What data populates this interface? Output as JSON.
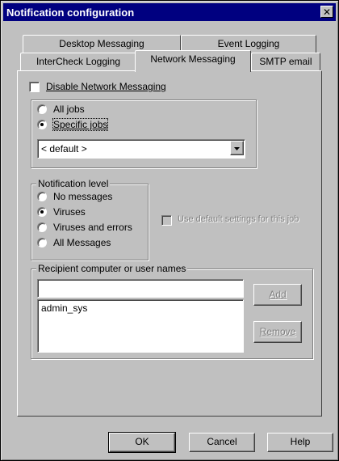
{
  "window": {
    "title": "Notification configuration",
    "close_icon": "close-icon"
  },
  "tabs": {
    "row1": [
      "Desktop Messaging",
      "Event Logging"
    ],
    "row2": [
      "InterCheck Logging",
      "Network Messaging",
      "SMTP email"
    ],
    "active": "Network Messaging"
  },
  "network": {
    "disable_label": "Disable Network Messaging",
    "disable_checked": false,
    "jobs": {
      "all_label": "All jobs",
      "specific_label": "Specific jobs",
      "selected": "Specific jobs",
      "dropdown_value": "< default >"
    },
    "level": {
      "title": "Notification level",
      "options": [
        "No messages",
        "Viruses",
        "Viruses and errors",
        "All Messages"
      ],
      "selected": "Viruses"
    },
    "use_default_label": "Use default settings for this job",
    "recipients": {
      "title": "Recipient computer or user names",
      "input_value": "",
      "list": [
        "admin_sys"
      ],
      "add_label": "Add",
      "remove_label": "Remove"
    }
  },
  "buttons": {
    "ok": "OK",
    "cancel": "Cancel",
    "help": "Help"
  },
  "colors": {
    "titlebar": "#000080",
    "face": "#c0c0c0"
  }
}
